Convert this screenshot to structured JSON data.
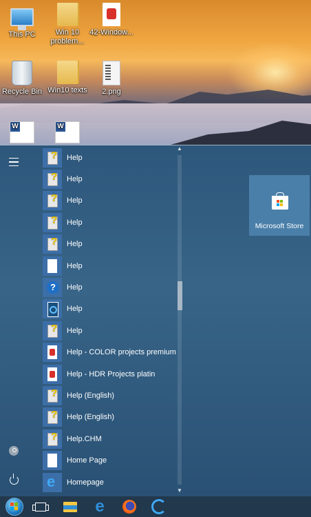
{
  "desktop": {
    "icons": [
      {
        "name": "this-pc",
        "label": "This PC"
      },
      {
        "name": "win10-problems-folder",
        "label": "Win 10 problem..."
      },
      {
        "name": "42-windows-pdf",
        "label": "42-Window..."
      },
      {
        "name": "recycle-bin",
        "label": "Recycle Bin"
      },
      {
        "name": "win10-texts-folder",
        "label": "Win10 texts"
      },
      {
        "name": "2-png",
        "label": "2.png"
      }
    ]
  },
  "start_menu": {
    "apps": [
      {
        "label": "Help",
        "icon": "chm-help-icon"
      },
      {
        "label": "Help",
        "icon": "chm-help-icon"
      },
      {
        "label": "Help",
        "icon": "chm-help-icon"
      },
      {
        "label": "Help",
        "icon": "chm-help-icon"
      },
      {
        "label": "Help",
        "icon": "chm-help-icon"
      },
      {
        "label": "Help",
        "icon": "document-icon"
      },
      {
        "label": "Help",
        "icon": "question-mark-icon"
      },
      {
        "label": "Help",
        "icon": "cyberlink-help-icon"
      },
      {
        "label": "Help",
        "icon": "chm-help-icon"
      },
      {
        "label": "Help - COLOR projects premium",
        "icon": "pdf-icon"
      },
      {
        "label": "Help - HDR Projects platin",
        "icon": "pdf-icon"
      },
      {
        "label": "Help (English)",
        "icon": "chm-help-icon"
      },
      {
        "label": "Help (English)",
        "icon": "chm-help-icon"
      },
      {
        "label": "Help.CHM",
        "icon": "chm-help-icon"
      },
      {
        "label": "Home Page",
        "icon": "document-icon"
      },
      {
        "label": "Homepage",
        "icon": "internet-explorer-icon"
      }
    ],
    "tiles": [
      {
        "label": "Microsoft Store",
        "icon": "store-bag-icon"
      }
    ],
    "scroll_position": 0.4
  },
  "taskbar": {
    "items": [
      "start-orb-icon",
      "task-view-icon",
      "file-explorer-icon",
      "edge-icon",
      "firefox-icon",
      "sync-app-icon"
    ]
  },
  "colors": {
    "start_bg": "#2e587d",
    "tile_bg": "#4a7fa9",
    "taskbar_bg": "#22384d",
    "app_icon_bg": "#3c6ea8"
  }
}
